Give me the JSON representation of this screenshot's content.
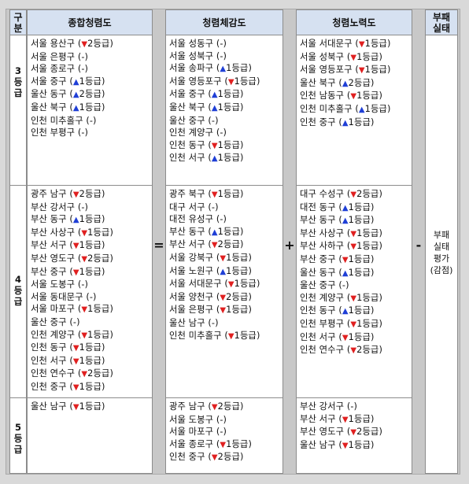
{
  "headers": {
    "category": "구분",
    "total": "종합청렴도",
    "perceived": "청렴체감도",
    "effort": "청렴노력도",
    "corruption": "부패실태"
  },
  "grades": {
    "g3": "3등급",
    "g4": "4등급",
    "g5": "5등급"
  },
  "operators": {
    "eq": "=",
    "plus": "+",
    "minus": "-"
  },
  "corruption_text": [
    "부패",
    "실태",
    "평가",
    "(감점)"
  ],
  "columns": {
    "total": {
      "g3": [
        {
          "n": "서울 용산구",
          "c": "down",
          "v": "2등급"
        },
        {
          "n": "서울 은평구",
          "c": "none"
        },
        {
          "n": "서울 종로구",
          "c": "none"
        },
        {
          "n": "서울 중구",
          "c": "up",
          "v": "1등급"
        },
        {
          "n": "울산 동구",
          "c": "up",
          "v": "2등급"
        },
        {
          "n": "울산 북구",
          "c": "up",
          "v": "1등급"
        },
        {
          "n": "인천 미추홀구",
          "c": "none"
        },
        {
          "n": "인천 부평구",
          "c": "none"
        }
      ],
      "g4": [
        {
          "n": "광주 남구",
          "c": "down",
          "v": "2등급"
        },
        {
          "n": "부산 강서구",
          "c": "none"
        },
        {
          "n": "부산 동구",
          "c": "up",
          "v": "1등급"
        },
        {
          "n": "부산 사상구",
          "c": "down",
          "v": "1등급"
        },
        {
          "n": "부산 서구",
          "c": "down",
          "v": "1등급"
        },
        {
          "n": "부산 영도구",
          "c": "down",
          "v": "2등급"
        },
        {
          "n": "부산 중구",
          "c": "down",
          "v": "1등급"
        },
        {
          "n": "서울 도봉구",
          "c": "none"
        },
        {
          "n": "서울 동대문구",
          "c": "none"
        },
        {
          "n": "서울 마포구",
          "c": "down",
          "v": "1등급"
        },
        {
          "n": "울산 중구",
          "c": "none"
        },
        {
          "n": "인천 계양구",
          "c": "down",
          "v": "1등급"
        },
        {
          "n": "인천 동구",
          "c": "down",
          "v": "1등급"
        },
        {
          "n": "인천 서구",
          "c": "down",
          "v": "1등급"
        },
        {
          "n": "인천 연수구",
          "c": "down",
          "v": "2등급"
        },
        {
          "n": "인천 중구",
          "c": "down",
          "v": "1등급"
        }
      ],
      "g5": [
        {
          "n": "울산 남구",
          "c": "down",
          "v": "1등급"
        }
      ]
    },
    "perceived": {
      "g3": [
        {
          "n": "서울 성동구",
          "c": "none"
        },
        {
          "n": "서울 성북구",
          "c": "none"
        },
        {
          "n": "서울 송파구",
          "c": "up",
          "v": "1등급"
        },
        {
          "n": "서울 영등포구",
          "c": "down",
          "v": "1등급"
        },
        {
          "n": "서울 중구",
          "c": "up",
          "v": "1등급"
        },
        {
          "n": "울산 북구",
          "c": "up",
          "v": "1등급"
        },
        {
          "n": "울산 중구",
          "c": "none"
        },
        {
          "n": "인천 계양구",
          "c": "none"
        },
        {
          "n": "인천 동구",
          "c": "down",
          "v": "1등급"
        },
        {
          "n": "인천 서구",
          "c": "up",
          "v": "1등급"
        }
      ],
      "g4": [
        {
          "n": "광주 북구",
          "c": "down",
          "v": "1등급"
        },
        {
          "n": "대구 서구",
          "c": "none"
        },
        {
          "n": "대전 유성구",
          "c": "none"
        },
        {
          "n": "부산 동구",
          "c": "up",
          "v": "1등급"
        },
        {
          "n": "부산 서구",
          "c": "down",
          "v": "2등급"
        },
        {
          "n": "서울 강북구",
          "c": "down",
          "v": "1등급"
        },
        {
          "n": "서울 노원구",
          "c": "up",
          "v": "1등급"
        },
        {
          "n": "서울 서대문구",
          "c": "down",
          "v": "1등급"
        },
        {
          "n": "서울 양천구",
          "c": "down",
          "v": "2등급"
        },
        {
          "n": "서울 은평구",
          "c": "down",
          "v": "1등급"
        },
        {
          "n": "울산 남구",
          "c": "none"
        },
        {
          "n": "인천 미추홀구",
          "c": "down",
          "v": "1등급"
        }
      ],
      "g5": [
        {
          "n": "광주 남구",
          "c": "down",
          "v": "2등급"
        },
        {
          "n": "서울 도봉구",
          "c": "none"
        },
        {
          "n": "서울 마포구",
          "c": "none"
        },
        {
          "n": "서울 종로구",
          "c": "down",
          "v": "1등급"
        },
        {
          "n": "인천 중구",
          "c": "down",
          "v": "2등급"
        }
      ]
    },
    "effort": {
      "g3": [
        {
          "n": "서울 서대문구",
          "c": "down",
          "v": "1등급"
        },
        {
          "n": "서울 성북구",
          "c": "down",
          "v": "1등급"
        },
        {
          "n": "서울 영등포구",
          "c": "down",
          "v": "1등급"
        },
        {
          "n": "울산 북구",
          "c": "up",
          "v": "2등급"
        },
        {
          "n": "인천 남동구",
          "c": "down",
          "v": "1등급"
        },
        {
          "n": "인천 미추홀구",
          "c": "up",
          "v": "1등급"
        },
        {
          "n": "인천 중구",
          "c": "up",
          "v": "1등급"
        }
      ],
      "g4": [
        {
          "n": "대구 수성구",
          "c": "down",
          "v": "2등급"
        },
        {
          "n": "대전 동구",
          "c": "up",
          "v": "1등급"
        },
        {
          "n": "부산 동구",
          "c": "up",
          "v": "1등급"
        },
        {
          "n": "부산 사상구",
          "c": "down",
          "v": "1등급"
        },
        {
          "n": "부산 사하구",
          "c": "down",
          "v": "1등급"
        },
        {
          "n": "부산 중구",
          "c": "down",
          "v": "1등급"
        },
        {
          "n": "울산 동구",
          "c": "up",
          "v": "1등급"
        },
        {
          "n": "울산 중구",
          "c": "none"
        },
        {
          "n": "인천 계양구",
          "c": "down",
          "v": "1등급"
        },
        {
          "n": "인천 동구",
          "c": "up",
          "v": "1등급"
        },
        {
          "n": "인천 부평구",
          "c": "down",
          "v": "1등급"
        },
        {
          "n": "인천 서구",
          "c": "down",
          "v": "1등급"
        },
        {
          "n": "인천 연수구",
          "c": "down",
          "v": "2등급"
        }
      ],
      "g5": [
        {
          "n": "부산 강서구",
          "c": "none"
        },
        {
          "n": "부산 서구",
          "c": "down",
          "v": "1등급"
        },
        {
          "n": "부산 영도구",
          "c": "down",
          "v": "2등급"
        },
        {
          "n": "울산 남구",
          "c": "down",
          "v": "1등급"
        }
      ]
    }
  }
}
